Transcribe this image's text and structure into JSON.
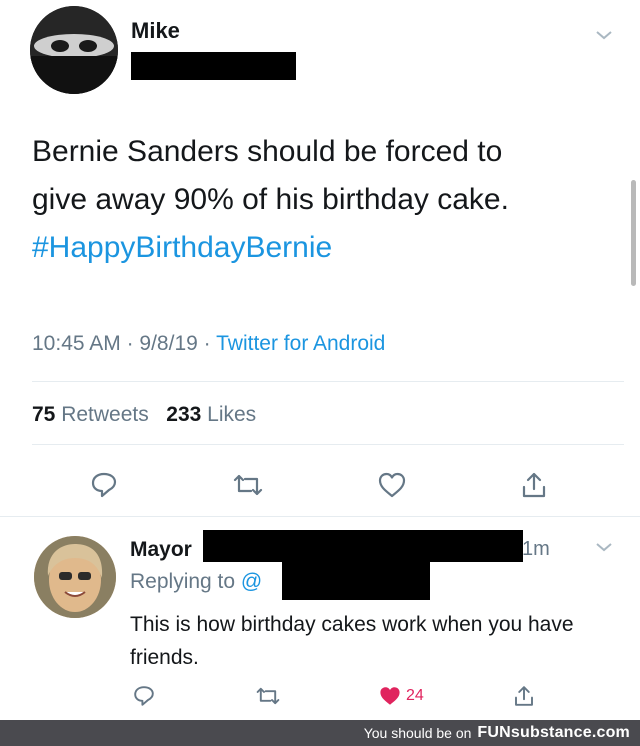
{
  "tweet": {
    "author_name": "Mike",
    "text_line1": "Bernie Sanders should be forced to",
    "text_line2": "give away 90% of his birthday cake.",
    "hashtag": "#HappyBirthdayBernie",
    "time": "10:45 AM",
    "date": "9/8/19",
    "source": "Twitter for Android",
    "separator": "·",
    "retweets_count": "75",
    "retweets_label": "Retweets",
    "likes_count": "233",
    "likes_label": "Likes"
  },
  "reply": {
    "author_name": "Mayor",
    "time": "1m",
    "replying_label": "Replying to",
    "replying_handle": "@",
    "text": "This is how birthday cakes work when you have friends.",
    "like_count": "24"
  },
  "watermark": {
    "prefix": "You should be on",
    "brand": "FUNsubstance.com"
  },
  "icons": {
    "reply": "reply-icon",
    "retweet": "retweet-icon",
    "like": "heart-icon",
    "share": "share-icon",
    "menu": "chevron-down-icon"
  },
  "colors": {
    "link": "#1b95e0",
    "secondary_text": "#657786",
    "liked": "#e0245e",
    "watermark_bg": "#4a4a4f"
  }
}
